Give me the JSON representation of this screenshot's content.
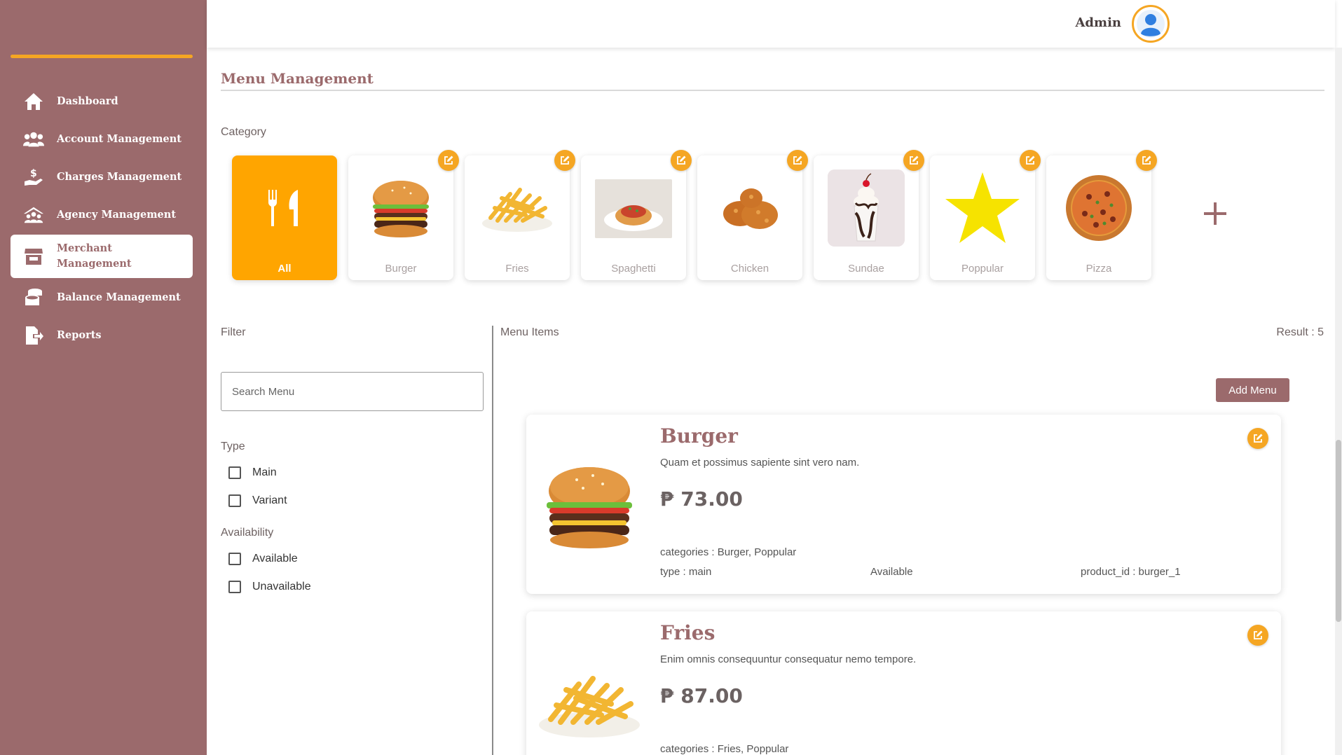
{
  "header": {
    "admin_name": "Admin"
  },
  "sidebar": {
    "items": [
      {
        "label": "Dashboard",
        "icon": "home-icon"
      },
      {
        "label": "Account Management",
        "icon": "users-icon"
      },
      {
        "label": "Charges Management",
        "icon": "hand-dollar-icon"
      },
      {
        "label": "Agency Management",
        "icon": "agency-icon"
      },
      {
        "label": "Merchant Management",
        "icon": "store-icon",
        "active": true
      },
      {
        "label": "Balance Management",
        "icon": "coins-icon"
      },
      {
        "label": "Reports",
        "icon": "report-export-icon"
      }
    ]
  },
  "page": {
    "title": "Menu Management"
  },
  "categories": {
    "label": "Category",
    "items": [
      {
        "name": "All",
        "icon": "utensils-icon",
        "active": true
      },
      {
        "name": "Burger",
        "icon": "burger-image"
      },
      {
        "name": "Fries",
        "icon": "fries-image"
      },
      {
        "name": "Spaghetti",
        "icon": "spaghetti-image"
      },
      {
        "name": "Chicken",
        "icon": "chicken-image"
      },
      {
        "name": "Sundae",
        "icon": "sundae-image"
      },
      {
        "name": "Poppular",
        "icon": "star-icon"
      },
      {
        "name": "Pizza",
        "icon": "pizza-image"
      }
    ],
    "add_icon": "plus-icon"
  },
  "filter": {
    "label": "Filter",
    "search_placeholder": "Search Menu",
    "type_label": "Type",
    "type_options": [
      "Main",
      "Variant"
    ],
    "availability_label": "Availability",
    "availability_options": [
      "Available",
      "Unavailable"
    ]
  },
  "menu": {
    "label": "Menu Items",
    "result": "Result : 5",
    "add_button": "Add Menu",
    "items": [
      {
        "name": "Burger",
        "description": "Quam et possimus sapiente sint vero nam.",
        "price": "₱ 73.00",
        "categories": "categories : Burger, Poppular",
        "type": "type : main",
        "availability": "Available",
        "product_id": "product_id : burger_1"
      },
      {
        "name": "Fries",
        "description": "Enim omnis consequuntur consequatur nemo tempore.",
        "price": "₱ 87.00",
        "categories": "categories : Fries, Poppular"
      }
    ]
  },
  "colors": {
    "sidebar": "#9b6a6c",
    "accent": "#f5a623",
    "active_category": "#ffa500"
  }
}
